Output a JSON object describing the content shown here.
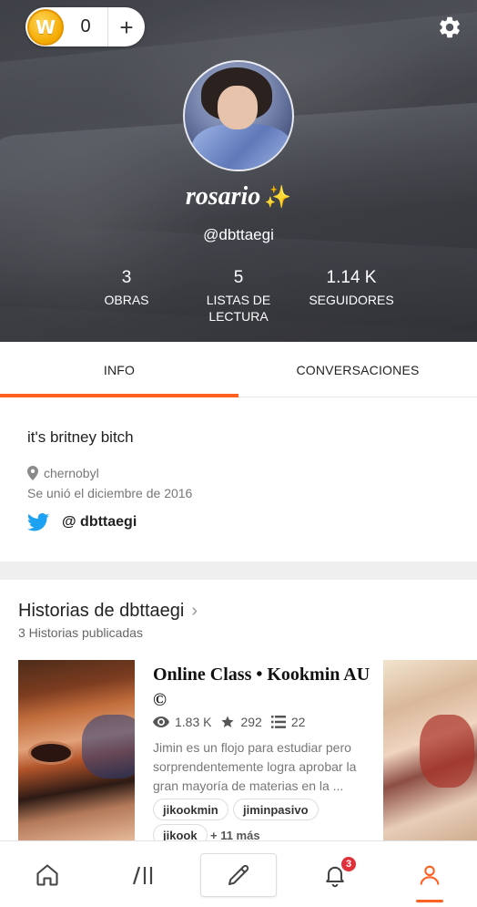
{
  "wallet": {
    "coin_symbol": "W",
    "coin_count": "0",
    "add_label": "+"
  },
  "profile": {
    "display_name": "rosario",
    "display_emoji": "✨",
    "handle": "@dbttaegi",
    "stats": [
      {
        "value": "3",
        "label": "OBRAS"
      },
      {
        "value": "5",
        "label": "LISTAS DE LECTURA"
      },
      {
        "value": "1.14 K",
        "label": "SEGUIDORES"
      }
    ]
  },
  "tabs": [
    {
      "label": "INFO",
      "active": true
    },
    {
      "label": "CONVERSACIONES",
      "active": false
    }
  ],
  "info": {
    "bio": "it's britney bitch",
    "location": "chernobyl",
    "joined": "Se unió el diciembre de 2016",
    "twitter": "@ dbttaegi"
  },
  "stories_section": {
    "title": "Historias de dbttaegi",
    "subtitle": "3 Historias publicadas",
    "story": {
      "title": "Online Class • Kookmin AU ©",
      "reads": "1.83 K",
      "votes": "292",
      "parts": "22",
      "description": "Jimin es un flojo para estudiar pero sorprendentemente logra aprobar la gran mayoría de materias en la ...",
      "tags": [
        "jikookmin",
        "jiminpasivo",
        "jikook"
      ],
      "more_tags": "+ 11 más"
    }
  },
  "bottom_nav": {
    "notification_count": "3",
    "items": [
      "home-icon",
      "library-icon",
      "pencil-icon",
      "bell-icon",
      "profile-icon"
    ]
  },
  "colors": {
    "accent": "#ff6122",
    "badge": "#e0303a",
    "twitter": "#1da1f2"
  }
}
